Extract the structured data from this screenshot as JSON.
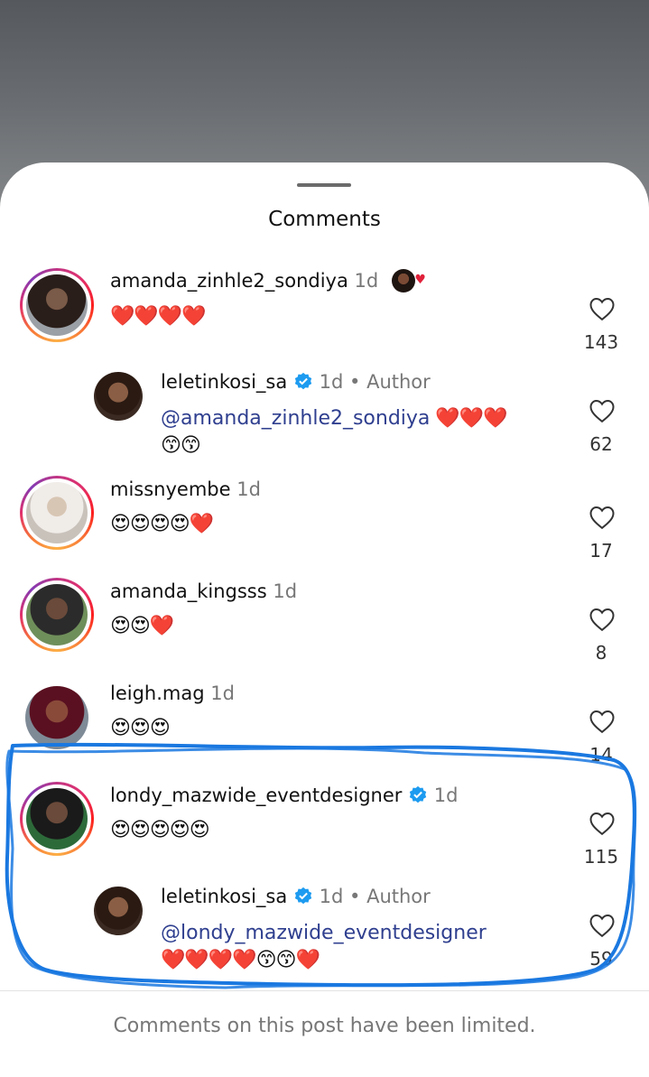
{
  "sheet": {
    "title": "Comments",
    "footer": "Comments on this post have been limited."
  },
  "comments": [
    {
      "username": "amanda_zinhle2_sondiya",
      "time": "1d",
      "text": "❤️❤️❤️❤️",
      "likes": "143",
      "has_story_ring": true,
      "liked_by_author_badge": true
    },
    {
      "username": "leletinkosi_sa",
      "verified": true,
      "time": "1d",
      "separator": "•",
      "author_label": "Author",
      "mention": "@amanda_zinhle2_sondiya",
      "text_after_mention": "❤️❤️❤️",
      "text_line2": "😙😙",
      "likes": "62",
      "is_reply": true
    },
    {
      "username": "missnyembe",
      "time": "1d",
      "text": "😍😍😍😍❤️",
      "likes": "17",
      "has_story_ring": true
    },
    {
      "username": "amanda_kingsss",
      "time": "1d",
      "text": "😍😍❤️",
      "likes": "8",
      "has_story_ring": true
    },
    {
      "username": "leigh.mag",
      "time": "1d",
      "text": "😍😍😍",
      "likes": "14"
    },
    {
      "username": "londy_mazwide_eventdesigner",
      "verified": true,
      "time": "1d",
      "text": "😍😍😍😍😍",
      "likes": "115",
      "has_story_ring": true
    },
    {
      "username": "leletinkosi_sa",
      "verified": true,
      "time": "1d",
      "separator": "•",
      "author_label": "Author",
      "mention": "@londy_mazwide_eventdesigner",
      "text_line2": "❤️❤️❤️❤️😙😙❤️",
      "likes": "59",
      "is_reply": true
    }
  ],
  "colors": {
    "annotation_scribble": "#1a78e0",
    "verified_badge": "#1d9bf0",
    "mention": "#2f3f8f",
    "heart": "#e0213a"
  },
  "icons": {
    "like": "heart-outline-icon",
    "verified": "verified-badge-icon",
    "handle": "drag-handle"
  }
}
